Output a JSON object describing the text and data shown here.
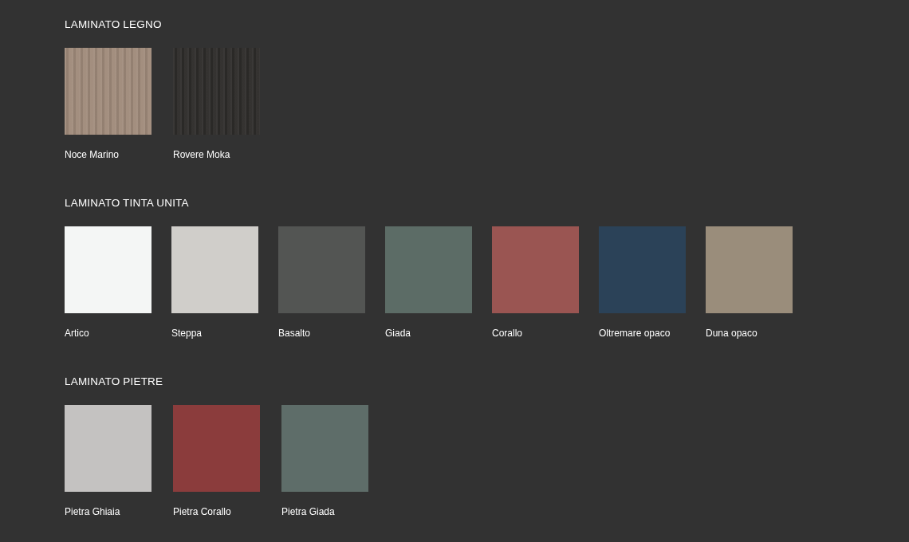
{
  "sections": [
    {
      "title": "LAMINATO LEGNO",
      "items": [
        {
          "name": "Noce Marino",
          "kind": "wood",
          "color": "#a08b7b"
        },
        {
          "name": "Rovere Moka",
          "kind": "wood",
          "color": "#2e2c2a"
        }
      ]
    },
    {
      "title": "LAMINATO TINTA UNITA",
      "items": [
        {
          "name": "Artico",
          "kind": "plain",
          "color": "#f4f6f5"
        },
        {
          "name": "Steppa",
          "kind": "plain",
          "color": "#d0ceca"
        },
        {
          "name": "Basalto",
          "kind": "plain",
          "color": "#535553"
        },
        {
          "name": "Giada",
          "kind": "plain",
          "color": "#5c6c66"
        },
        {
          "name": "Corallo",
          "kind": "plain",
          "color": "#9a5552"
        },
        {
          "name": "Oltremare opaco",
          "kind": "plain",
          "color": "#2b4258"
        },
        {
          "name": "Duna opaco",
          "kind": "plain",
          "color": "#9a8d7b"
        }
      ]
    },
    {
      "title": "LAMINATO PIETRE",
      "items": [
        {
          "name": "Pietra Ghiaia",
          "kind": "stone",
          "color": "#c4c2c1"
        },
        {
          "name": "Pietra Corallo",
          "kind": "stone",
          "color": "#8b3c3c"
        },
        {
          "name": "Pietra Giada",
          "kind": "stone",
          "color": "#5e6d69"
        }
      ]
    }
  ]
}
